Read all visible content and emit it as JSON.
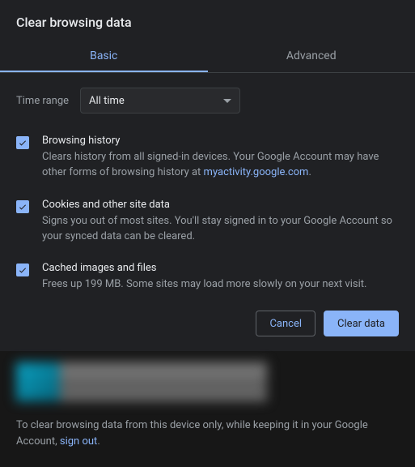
{
  "dialog": {
    "title": "Clear browsing data",
    "tabs": {
      "basic": "Basic",
      "advanced": "Advanced"
    },
    "timerange": {
      "label": "Time range",
      "value": "All time"
    },
    "options": {
      "history": {
        "title": "Browsing history",
        "desc_before": "Clears history from all signed-in devices. Your Google Account may have other forms of browsing history at ",
        "link": "myactivity.google.com",
        "desc_after": "."
      },
      "cookies": {
        "title": "Cookies and other site data",
        "desc": "Signs you out of most sites. You'll stay signed in to your Google Account so your synced data can be cleared."
      },
      "cache": {
        "title": "Cached images and files",
        "desc": "Frees up 199 MB. Some sites may load more slowly on your next visit."
      }
    },
    "buttons": {
      "cancel": "Cancel",
      "clear": "Clear data"
    },
    "footer": {
      "text_before": "To clear browsing data from this device only, while keeping it in your Google Account, ",
      "link": "sign out",
      "text_after": "."
    }
  }
}
